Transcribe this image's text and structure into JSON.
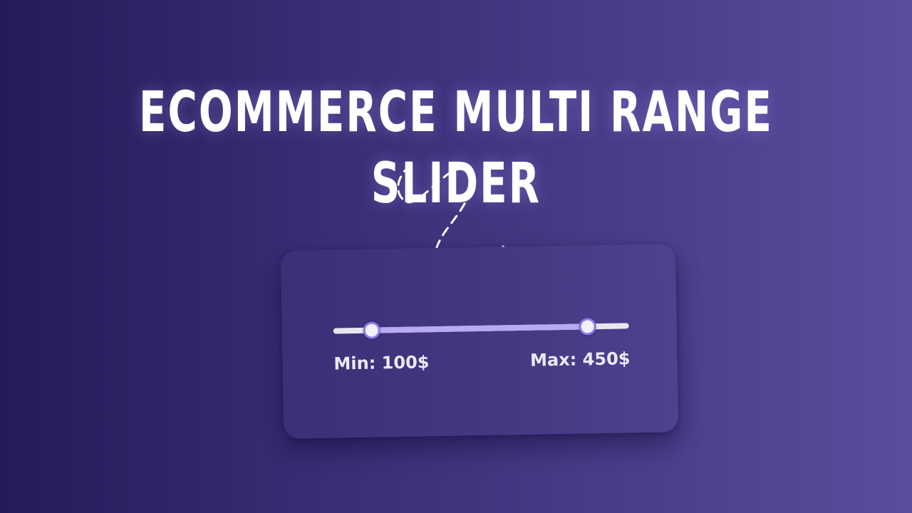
{
  "title": "ECOMMERCE MULTI RANGE SLIDER",
  "slider": {
    "min_label": "Min: 100$",
    "max_label": "Max: 450$",
    "min_value_fraction": 0.13,
    "max_value_fraction": 0.86
  },
  "colors": {
    "background_start": "#241b58",
    "background_end": "#5a4d9d",
    "card": "#43377f",
    "track": "#e9e6ef",
    "track_fill": "#b9aaf2",
    "thumb_border": "#8a78ea",
    "text": "#ffffff"
  },
  "icons": {
    "doodle": "dashed-arrow-doodle-icon"
  }
}
